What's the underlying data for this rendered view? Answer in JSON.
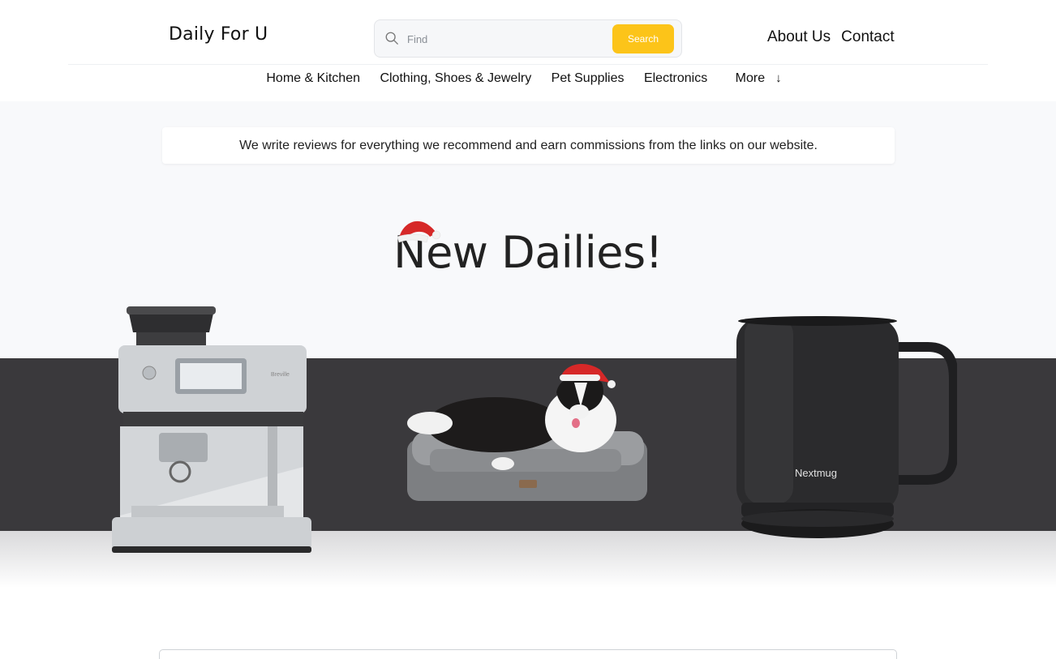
{
  "header": {
    "logo": "Daily For U",
    "search_placeholder": "Find",
    "search_button": "Search",
    "links": [
      "About Us",
      "Contact"
    ]
  },
  "categories": [
    "Home & Kitchen",
    "Clothing, Shoes & Jewelry",
    "Pet Supplies",
    "Electronics",
    "More"
  ],
  "hero": {
    "disclaimer": "We write reviews for everything we recommend and earn commissions from the links on our website.",
    "title": "New Dailies!",
    "products": [
      {
        "name": "espresso-machine",
        "brand_label": "Breville"
      },
      {
        "name": "dog-bed",
        "brand_label": ""
      },
      {
        "name": "smart-mug",
        "brand_label": "Nextmug"
      }
    ]
  },
  "colors": {
    "accent": "#fcc419",
    "band": "#3a393c",
    "hero_bg": "#f8f9fb"
  }
}
